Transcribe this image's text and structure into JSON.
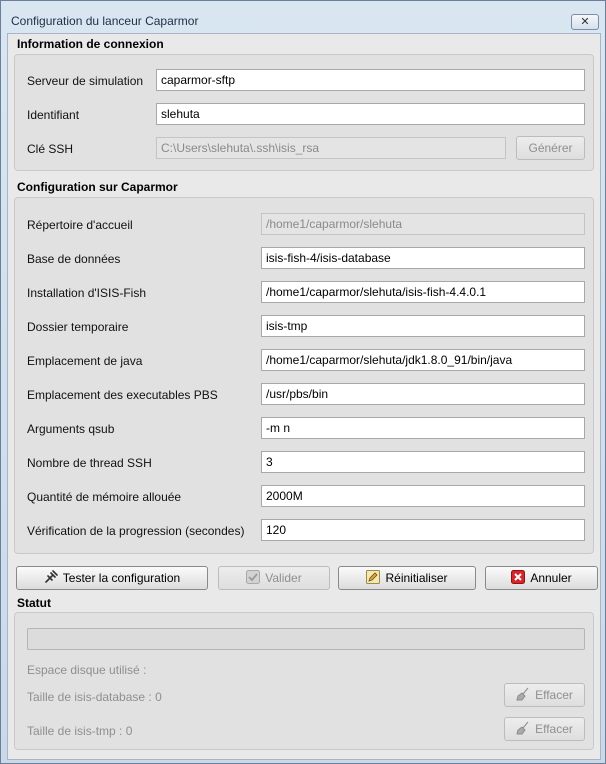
{
  "window": {
    "title": "Configuration du lanceur Caparmor",
    "close_glyph": "✕"
  },
  "connection": {
    "title": "Information de connexion",
    "server_label": "Serveur de simulation",
    "server_value": "caparmor-sftp",
    "login_label": "Identifiant",
    "login_value": "slehuta",
    "ssh_label": "Clé SSH",
    "ssh_value": "C:\\Users\\slehuta\\.ssh\\isis_rsa",
    "generate_label": "Générer"
  },
  "caparmor": {
    "title": "Configuration sur Caparmor",
    "home_label": "Répertoire d'accueil",
    "home_value": "/home1/caparmor/slehuta",
    "db_label": "Base de données",
    "db_value": "isis-fish-4/isis-database",
    "install_label": "Installation d'ISIS-Fish",
    "install_value": "/home1/caparmor/slehuta/isis-fish-4.4.0.1",
    "tmp_label": "Dossier temporaire",
    "tmp_value": "isis-tmp",
    "java_label": "Emplacement de java",
    "java_value": "/home1/caparmor/slehuta/jdk1.8.0_91/bin/java",
    "pbs_label": "Emplacement des executables PBS",
    "pbs_value": "/usr/pbs/bin",
    "qsub_label": "Arguments qsub",
    "qsub_value": "-m n",
    "thread_label": "Nombre de thread SSH",
    "thread_value": "3",
    "mem_label": "Quantité de mémoire allouée",
    "mem_value": "2000M",
    "check_label": "Vérification de la progression (secondes)",
    "check_value": "120"
  },
  "actions": {
    "test_label": "Tester la configuration",
    "validate_label": "Valider",
    "reset_label": "Réinitialiser",
    "cancel_label": "Annuler"
  },
  "status": {
    "title": "Statut",
    "progress": 0,
    "disk_label": "Espace disque utilisé :",
    "db_size_label": "Taille de isis-database : 0",
    "tmp_size_label": "Taille de isis-tmp : 0",
    "clear_label": "Effacer"
  },
  "icons": {
    "test": "plug-icon",
    "validate": "check-icon",
    "reset": "pencil-icon",
    "cancel": "cancel-icon",
    "clear": "broom-icon"
  },
  "colors": {
    "cancel_red": "#d7262b",
    "accent_green": "#6fae5e"
  }
}
